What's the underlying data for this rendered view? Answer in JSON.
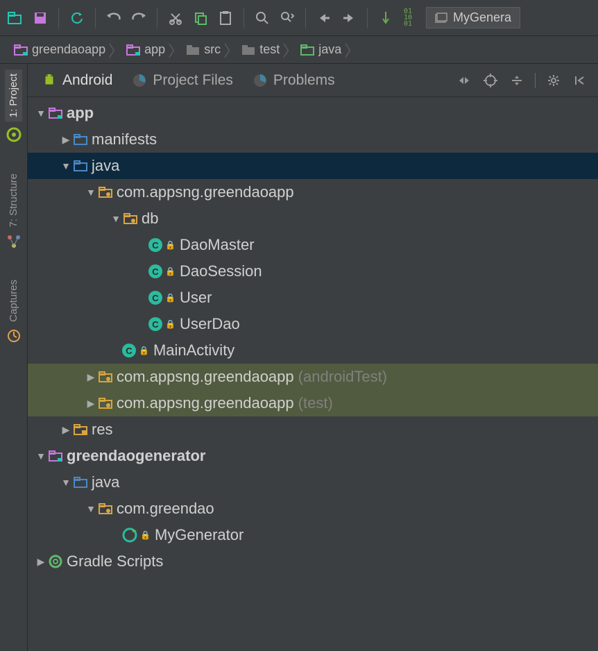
{
  "toolbar": {
    "open_tab_label": "MyGenera"
  },
  "breadcrumb": [
    {
      "label": "greendaoapp",
      "icon": "module"
    },
    {
      "label": "app",
      "icon": "module"
    },
    {
      "label": "src",
      "icon": "folder"
    },
    {
      "label": "test",
      "icon": "folder"
    },
    {
      "label": "java",
      "icon": "src-folder"
    }
  ],
  "sidebar_tools": [
    {
      "label": "1: Project",
      "active": true
    },
    {
      "label": "7: Structure",
      "active": false
    },
    {
      "label": "Captures",
      "active": false
    }
  ],
  "panel_tabs": [
    {
      "label": "Android",
      "icon": "android"
    },
    {
      "label": "Project Files",
      "icon": "pie"
    },
    {
      "label": "Problems",
      "icon": "pie"
    }
  ],
  "tree": {
    "app": "app",
    "manifests": "manifests",
    "java": "java",
    "pkg_main": "com.appsng.greendaoapp",
    "db": "db",
    "DaoMaster": "DaoMaster",
    "DaoSession": "DaoSession",
    "User": "User",
    "UserDao": "UserDao",
    "MainActivity": "MainActivity",
    "pkg_androidTest": "com.appsng.greendaoapp",
    "pkg_androidTest_suffix": "(androidTest)",
    "pkg_test": "com.appsng.greendaoapp",
    "pkg_test_suffix": "(test)",
    "res": "res",
    "greendaogenerator": "greendaogenerator",
    "java2": "java",
    "com_greendao": "com.greendao",
    "MyGenerator": "MyGenerator",
    "gradle_scripts": "Gradle Scripts"
  }
}
